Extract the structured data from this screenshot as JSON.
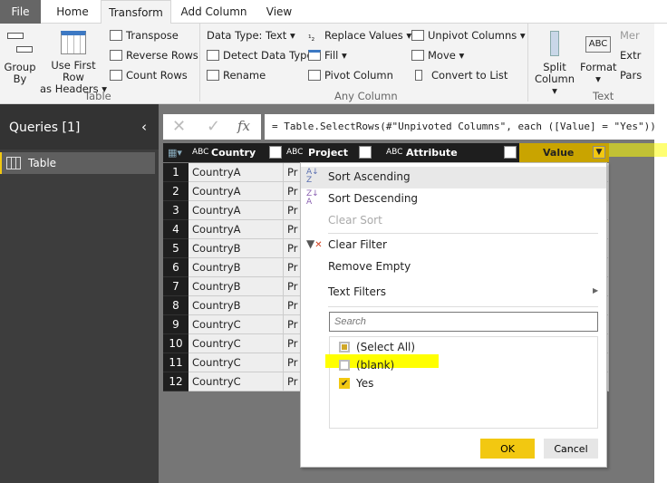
{
  "tabs": [
    "File",
    "Home",
    "Transform",
    "Add Column",
    "View"
  ],
  "active_tab": "Transform",
  "ribbon": {
    "group_by": "Group By",
    "use_first_row": "Use First Row",
    "as_headers": "as Headers ▾",
    "transpose": "Transpose",
    "reverse_rows": "Reverse Rows",
    "count_rows": "Count Rows",
    "table_group": "Table",
    "data_type": "Data Type: Text ▾",
    "detect_data_type": "Detect Data Type",
    "rename": "Rename",
    "replace_values": "Replace Values ▾",
    "fill": "Fill ▾",
    "pivot_column": "Pivot Column",
    "unpivot_columns": "Unpivot Columns ▾",
    "move": "Move ▾",
    "convert_to_list": "Convert to List",
    "any_column_group": "Any Column",
    "split_column": "Split",
    "split_column2": "Column ▾",
    "format": "Format",
    "format2": "▾",
    "merge": "Mer",
    "extract": "Extr",
    "parse": "Pars",
    "text_column_group": "Text Column"
  },
  "queries": {
    "title": "Queries [1]",
    "items": [
      "Table"
    ]
  },
  "formula": "= Table.SelectRows(#\"Unpivoted Columns\", each ([Value] = \"Yes\"))",
  "columns": [
    "Country",
    "Project",
    "Attribute",
    "Value"
  ],
  "rows": [
    {
      "n": "1",
      "country": "CountryA",
      "project": "Pr"
    },
    {
      "n": "2",
      "country": "CountryA",
      "project": "Pr"
    },
    {
      "n": "3",
      "country": "CountryA",
      "project": "Pr"
    },
    {
      "n": "4",
      "country": "CountryA",
      "project": "Pr"
    },
    {
      "n": "5",
      "country": "CountryB",
      "project": "Pr"
    },
    {
      "n": "6",
      "country": "CountryB",
      "project": "Pr"
    },
    {
      "n": "7",
      "country": "CountryB",
      "project": "Pr"
    },
    {
      "n": "8",
      "country": "CountryB",
      "project": "Pr"
    },
    {
      "n": "9",
      "country": "CountryC",
      "project": "Pr"
    },
    {
      "n": "10",
      "country": "CountryC",
      "project": "Pr"
    },
    {
      "n": "11",
      "country": "CountryC",
      "project": "Pr"
    },
    {
      "n": "12",
      "country": "CountryC",
      "project": "Pr"
    }
  ],
  "menu": {
    "sort_asc": "Sort Ascending",
    "sort_desc": "Sort Descending",
    "clear_sort": "Clear Sort",
    "clear_filter": "Clear Filter",
    "remove_empty": "Remove Empty",
    "text_filters": "Text Filters",
    "search_placeholder": "Search",
    "options": [
      {
        "label": "(Select All)",
        "state": "partial"
      },
      {
        "label": "(blank)",
        "state": "unchecked"
      },
      {
        "label": "Yes",
        "state": "checked"
      }
    ],
    "ok": "OK",
    "cancel": "Cancel"
  },
  "colors": {
    "accent": "#f2c811",
    "highlight": "#ffff00",
    "value_header": "#c9a400"
  }
}
